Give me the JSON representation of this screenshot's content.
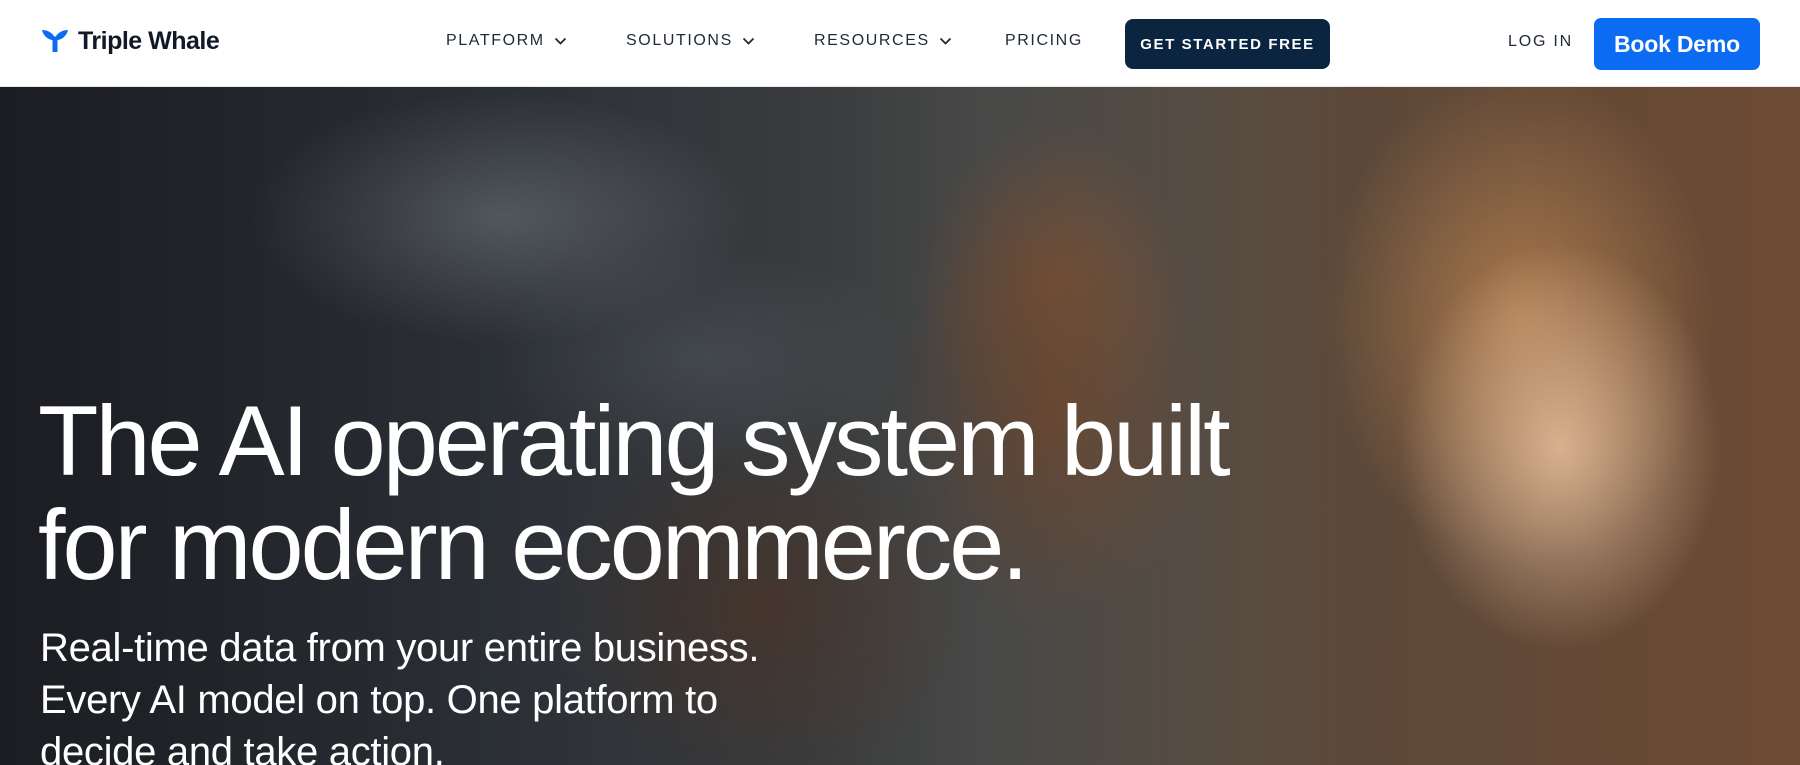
{
  "brand": {
    "name": "Triple Whale",
    "logo_icon": "whale-tail-icon",
    "accent": "#0b6bf2",
    "dark": "#0b2540"
  },
  "nav": {
    "items": [
      {
        "label": "PLATFORM",
        "has_dropdown": true
      },
      {
        "label": "SOLUTIONS",
        "has_dropdown": true
      },
      {
        "label": "RESOURCES",
        "has_dropdown": true
      },
      {
        "label": "PRICING",
        "has_dropdown": false
      }
    ],
    "cta_start": "GET STARTED FREE",
    "login": "LOG IN",
    "cta_demo": "Book Demo"
  },
  "hero": {
    "title_line1": "The AI operating system built",
    "title_line2": "for modern ecommerce.",
    "subtitle_line1": "Real-time data from your entire business.",
    "subtitle_line2": "Every AI model on top. One platform to",
    "subtitle_line3": "decide and take action."
  }
}
